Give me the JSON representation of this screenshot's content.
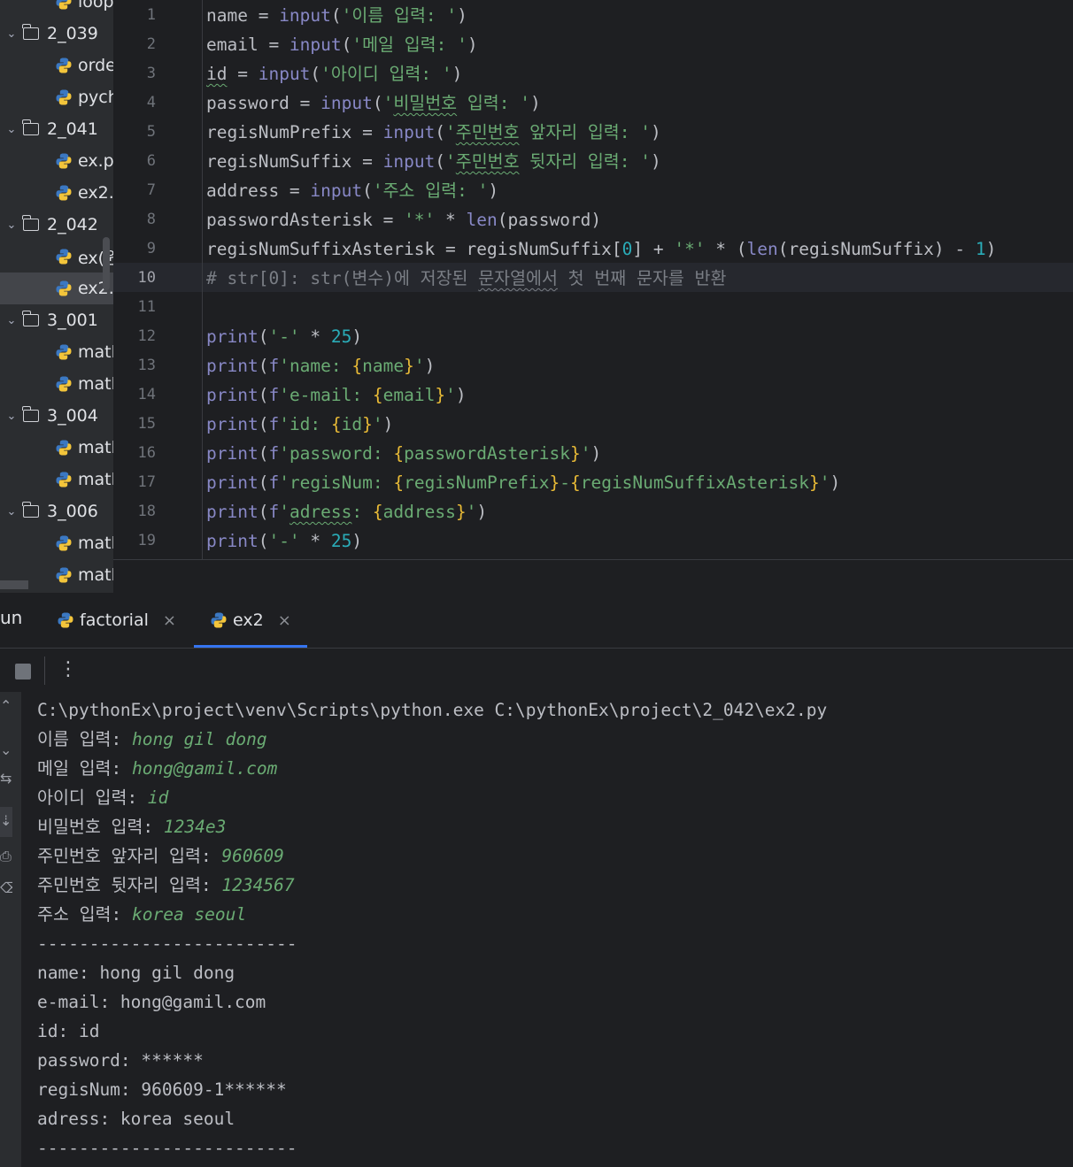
{
  "project_tree": {
    "items": [
      {
        "type": "file",
        "label": "loop"
      },
      {
        "type": "folder",
        "label": "2_039"
      },
      {
        "type": "file",
        "label": "orde"
      },
      {
        "type": "file",
        "label": "pych"
      },
      {
        "type": "folder",
        "label": "2_041"
      },
      {
        "type": "file",
        "label": "ex.p"
      },
      {
        "type": "file",
        "label": "ex2."
      },
      {
        "type": "folder",
        "label": "2_042"
      },
      {
        "type": "file",
        "label": "ex(원"
      },
      {
        "type": "file",
        "label": "ex2.",
        "selected": true
      },
      {
        "type": "folder",
        "label": "3_001"
      },
      {
        "type": "file",
        "label": "matl"
      },
      {
        "type": "file",
        "label": "matl"
      },
      {
        "type": "folder",
        "label": "3_004"
      },
      {
        "type": "file",
        "label": "matl"
      },
      {
        "type": "file",
        "label": "matl"
      },
      {
        "type": "folder",
        "label": "3_006"
      },
      {
        "type": "file",
        "label": "matl"
      },
      {
        "type": "file",
        "label": "matl"
      }
    ]
  },
  "editor": {
    "current_line": 10,
    "line_numbers": [
      "1",
      "2",
      "3",
      "4",
      "5",
      "6",
      "7",
      "8",
      "9",
      "10",
      "11",
      "12",
      "13",
      "14",
      "15",
      "16",
      "17",
      "18",
      "19"
    ],
    "lines": [
      "name = input('이름 입력: ')",
      "email = input('메일 입력: ')",
      "id = input('아이디 입력: ')",
      "password = input('비밀번호 입력: ')",
      "regisNumPrefix = input('주민번호 앞자리 입력: ')",
      "regisNumSuffix = input('주민번호 뒷자리 입력: ')",
      "address = input('주소 입력: ')",
      "passwordAsterisk = '*' * len(password)",
      "regisNumSuffixAsterisk = regisNumSuffix[0] + '*' * (len(regisNumSuffix) - 1)",
      "# str[0]: str(변수)에 저장된 문자열에서 첫 번째 문자를 반환",
      "",
      "print('-' * 25)",
      "print(f'name: {name}')",
      "print(f'e-mail: {email}')",
      "print(f'id: {id}')",
      "print(f'password: {passwordAsterisk}')",
      "print(f'regisNum: {regisNumPrefix}-{regisNumSuffixAsterisk}')",
      "print(f'adress: {address}')",
      "print('-' * 25)"
    ]
  },
  "run_panel": {
    "label": "un",
    "tabs": [
      {
        "label": "factorial",
        "active": false
      },
      {
        "label": "ex2",
        "active": true
      }
    ],
    "close_glyph": "×",
    "more_glyph": "⋮"
  },
  "console": {
    "lines": [
      {
        "text": "C:\\pythonEx\\project\\venv\\Scripts\\python.exe C:\\pythonEx\\project\\2_042\\ex2.py",
        "input": ""
      },
      {
        "text": "이름 입력: ",
        "input": "hong gil dong"
      },
      {
        "text": "메일 입력: ",
        "input": "hong@gamil.com"
      },
      {
        "text": "아이디 입력: ",
        "input": "id"
      },
      {
        "text": "비밀번호 입력: ",
        "input": "1234e3"
      },
      {
        "text": "주민번호 앞자리 입력: ",
        "input": "960609"
      },
      {
        "text": "주민번호 뒷자리 입력: ",
        "input": "1234567"
      },
      {
        "text": "주소 입력: ",
        "input": "korea seoul"
      },
      {
        "text": "-------------------------",
        "input": ""
      },
      {
        "text": "name: hong gil dong",
        "input": ""
      },
      {
        "text": "e-mail: hong@gamil.com",
        "input": ""
      },
      {
        "text": "id: id",
        "input": ""
      },
      {
        "text": "password: ******",
        "input": ""
      },
      {
        "text": "regisNum: 960609-1******",
        "input": ""
      },
      {
        "text": "adress: korea seoul",
        "input": ""
      },
      {
        "text": "-------------------------",
        "input": ""
      }
    ]
  },
  "colors": {
    "keyword": "#8888c6",
    "string": "#6aab73",
    "number": "#2aacb8",
    "brace": "#e8ba36",
    "comment": "#7a7e85",
    "accent": "#3574f0"
  }
}
